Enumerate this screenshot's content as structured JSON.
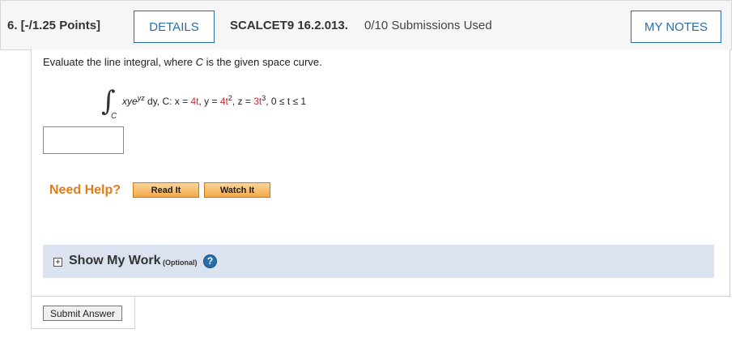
{
  "header": {
    "question_number": "6. [-/1.25 Points]",
    "details_label": "DETAILS",
    "problem_code": "SCALCET9 16.2.013.",
    "submissions": "0/10 Submissions Used",
    "notes_label": "MY NOTES"
  },
  "question": {
    "prompt_before": "Evaluate the line integral, where ",
    "prompt_var": "C",
    "prompt_after": " is the given space curve.",
    "integral_sub": "C",
    "integrand": "xye",
    "integrand_exp": "yz",
    "differential": " dy,   C: x = ",
    "x_val": "4t",
    "y_label": ",  y = ",
    "y_val": "4t",
    "y_exp": "2",
    "z_label": ",  z = ",
    "z_val": "3t",
    "z_exp": "3",
    "range": ",   0 ≤ t ≤ 1"
  },
  "answer": {
    "value": ""
  },
  "help": {
    "need_help": "Need Help?",
    "read_it": "Read It",
    "watch_it": "Watch It"
  },
  "work": {
    "toggle": "+",
    "title": "Show My Work",
    "optional": "(Optional)",
    "help_icon": "?"
  },
  "submit": {
    "label": "Submit Answer"
  },
  "colors": {
    "accent": "#2a6ea9",
    "need_help": "#e27b1a",
    "highlight_value": "#c53030",
    "work_bar": "#dae3ef"
  },
  "icons": {
    "toggle": "plus-box-icon",
    "help": "question-circle-icon"
  }
}
